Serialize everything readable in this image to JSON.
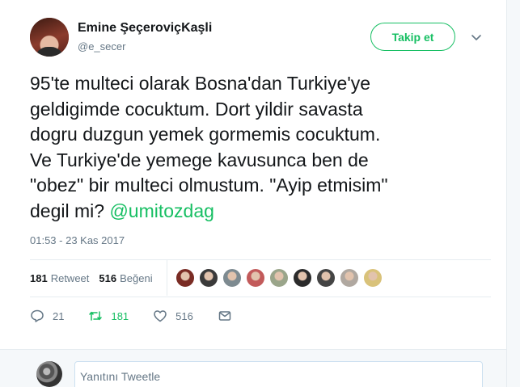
{
  "user": {
    "name": "Emine ŞeçeroviçKaşli",
    "handle": "@e_secer"
  },
  "follow_button": {
    "label": "Takip et"
  },
  "tweet": {
    "text_lines": [
      "95'te multeci olarak Bosna'dan Turkiye'ye",
      "geldigimde cocuktum. Dort yildir savasta",
      "dogru duzgun yemek gormemis cocuktum.",
      "Ve Turkiye'de yemege kavusunca ben de",
      "\"obez\" bir multeci olmustum. \"Ayip etmisim\"",
      "degil mi?"
    ],
    "mention": "@umitozdag",
    "timestamp": "01:53 - 23 Kas 2017"
  },
  "stats": {
    "retweet_count": "181",
    "retweet_label": "Retweet",
    "like_count": "516",
    "like_label": "Beğeni"
  },
  "liker_avatars": [
    {
      "color": "#7a2c24"
    },
    {
      "color": "#3a3a3a"
    },
    {
      "color": "#7d8a90"
    },
    {
      "color": "#c25a5a"
    },
    {
      "color": "#9aa58a"
    },
    {
      "color": "#2b2b2b"
    },
    {
      "color": "#444444"
    },
    {
      "color": "#b0a8a0"
    },
    {
      "color": "#d9c27a"
    }
  ],
  "actions": {
    "reply_count": "21",
    "retweet_count": "181",
    "like_count": "516"
  },
  "reply_box": {
    "placeholder": "Yanıtını Tweetle"
  },
  "colors": {
    "accent": "#17bf63",
    "secondary_text": "#657786",
    "border": "#e6ecf0"
  }
}
